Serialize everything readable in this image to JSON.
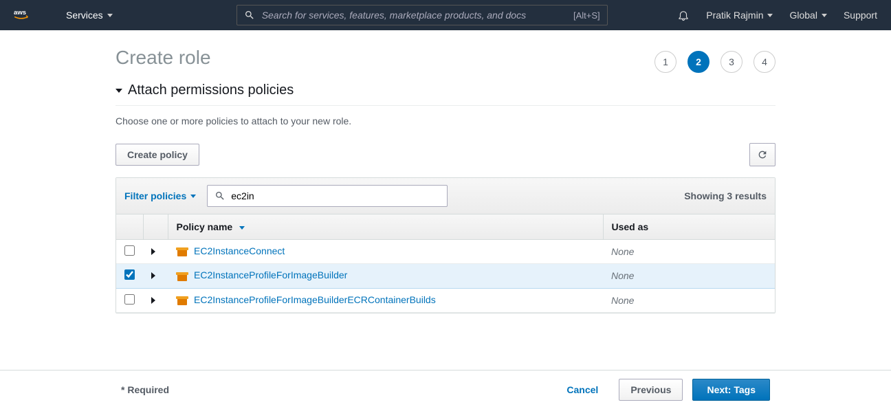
{
  "topnav": {
    "services_label": "Services",
    "search_placeholder": "Search for services, features, marketplace products, and docs",
    "search_shortcut": "[Alt+S]",
    "username": "Pratik Rajmin",
    "region": "Global",
    "support": "Support"
  },
  "page": {
    "title": "Create role",
    "section_title": "Attach permissions policies",
    "section_desc": "Choose one or more policies to attach to your new role.",
    "create_policy_label": "Create policy",
    "filter_label": "Filter policies",
    "filter_value": "ec2in",
    "results_text": "Showing 3 results",
    "col_policy_name": "Policy name",
    "col_used_as": "Used as",
    "required_note": "* Required"
  },
  "steps": [
    "1",
    "2",
    "3",
    "4"
  ],
  "active_step": 2,
  "policies": [
    {
      "name": "EC2InstanceConnect",
      "used_as": "None",
      "selected": false
    },
    {
      "name": "EC2InstanceProfileForImageBuilder",
      "used_as": "None",
      "selected": true
    },
    {
      "name": "EC2InstanceProfileForImageBuilderECRContainerBuilds",
      "used_as": "None",
      "selected": false
    }
  ],
  "footer": {
    "cancel": "Cancel",
    "previous": "Previous",
    "next": "Next: Tags"
  }
}
